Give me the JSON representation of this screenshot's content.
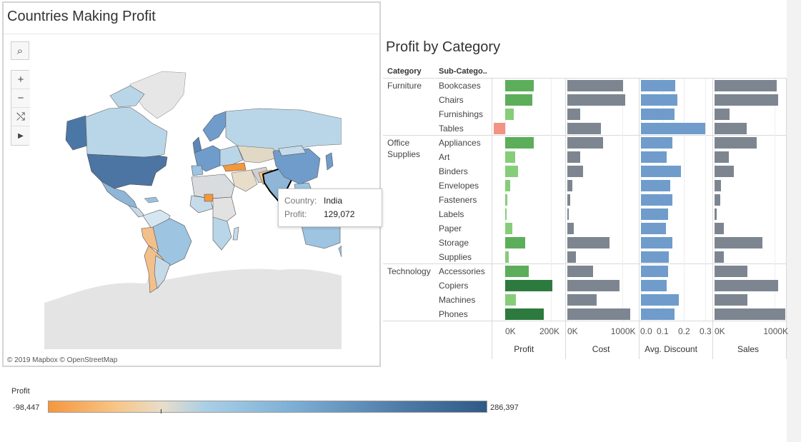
{
  "map": {
    "title": "Countries Making Profit",
    "credit": "© 2019 Mapbox © OpenStreetMap",
    "tools": [
      {
        "name": "search-icon",
        "glyph": "⌕"
      },
      {
        "name": "zoom-in-icon",
        "glyph": "+"
      },
      {
        "name": "zoom-out-icon",
        "glyph": "−"
      },
      {
        "name": "reset-map-icon",
        "glyph": "⤭"
      },
      {
        "name": "expand-toolbar-icon",
        "glyph": "▶"
      }
    ],
    "tooltip": {
      "country_label": "Country:",
      "country_value": "India",
      "profit_label": "Profit:",
      "profit_value": "129,072"
    }
  },
  "legend": {
    "title": "Profit",
    "min_label": "-98,447",
    "max_label": "286,397"
  },
  "chart_data": {
    "type": "bar",
    "title": "Profit by Category",
    "row_headers": [
      "Category",
      "Sub-Catego.."
    ],
    "categories": [
      "Furniture",
      "Office Supplies",
      "Technology"
    ],
    "category_lines": [
      [
        "Furniture"
      ],
      [
        "Office",
        "Supplies"
      ],
      [
        "Technology"
      ]
    ],
    "rows": [
      {
        "category": "Furniture",
        "sub": "Bookcases"
      },
      {
        "category": "Furniture",
        "sub": "Chairs"
      },
      {
        "category": "Furniture",
        "sub": "Furnishings"
      },
      {
        "category": "Furniture",
        "sub": "Tables"
      },
      {
        "category": "Office Supplies",
        "sub": "Appliances"
      },
      {
        "category": "Office Supplies",
        "sub": "Art"
      },
      {
        "category": "Office Supplies",
        "sub": "Binders"
      },
      {
        "category": "Office Supplies",
        "sub": "Envelopes"
      },
      {
        "category": "Office Supplies",
        "sub": "Fasteners"
      },
      {
        "category": "Office Supplies",
        "sub": "Labels"
      },
      {
        "category": "Office Supplies",
        "sub": "Paper"
      },
      {
        "category": "Office Supplies",
        "sub": "Storage"
      },
      {
        "category": "Office Supplies",
        "sub": "Supplies"
      },
      {
        "category": "Technology",
        "sub": "Accessories"
      },
      {
        "category": "Technology",
        "sub": "Copiers"
      },
      {
        "category": "Technology",
        "sub": "Machines"
      },
      {
        "category": "Technology",
        "sub": "Phones"
      }
    ],
    "measures": [
      {
        "name": "Profit",
        "ticks": [
          "0K",
          "200K"
        ],
        "range": [
          -50000,
          250000
        ],
        "values": [
          126000,
          118000,
          36000,
          -51000,
          124000,
          45000,
          57000,
          22000,
          8000,
          7000,
          31000,
          86000,
          16000,
          102000,
          206000,
          46000,
          168000
        ]
      },
      {
        "name": "Cost",
        "ticks": [
          "0K",
          "1000K"
        ],
        "range": [
          0,
          1250000
        ],
        "values": [
          1010000,
          1050000,
          240000,
          610000,
          650000,
          230000,
          280000,
          90000,
          50000,
          30000,
          120000,
          770000,
          160000,
          470000,
          950000,
          530000,
          1140000
        ]
      },
      {
        "name": "Avg. Discount",
        "ticks": [
          "0.0",
          "0.1",
          "0.2",
          "0.3"
        ],
        "range": [
          0,
          0.32
        ],
        "values": [
          0.16,
          0.17,
          0.155,
          0.3,
          0.145,
          0.12,
          0.185,
          0.135,
          0.145,
          0.125,
          0.115,
          0.145,
          0.13,
          0.125,
          0.12,
          0.175,
          0.155
        ]
      },
      {
        "name": "Sales",
        "ticks": [
          "0K",
          "1000K"
        ],
        "range": [
          0,
          1150000
        ],
        "values": [
          1030000,
          1050000,
          250000,
          530000,
          700000,
          240000,
          320000,
          110000,
          90000,
          40000,
          160000,
          790000,
          160000,
          540000,
          1060000,
          550000,
          1200000
        ]
      }
    ],
    "colors": {
      "cost": "#7d8690",
      "discount": "#6f9ccb",
      "sales": "#7d8690",
      "profit_neg": "#f29383",
      "profit_light": "#86cd7a",
      "profit_mid": "#5cae5b",
      "profit_dark": "#2d7a3e"
    }
  }
}
